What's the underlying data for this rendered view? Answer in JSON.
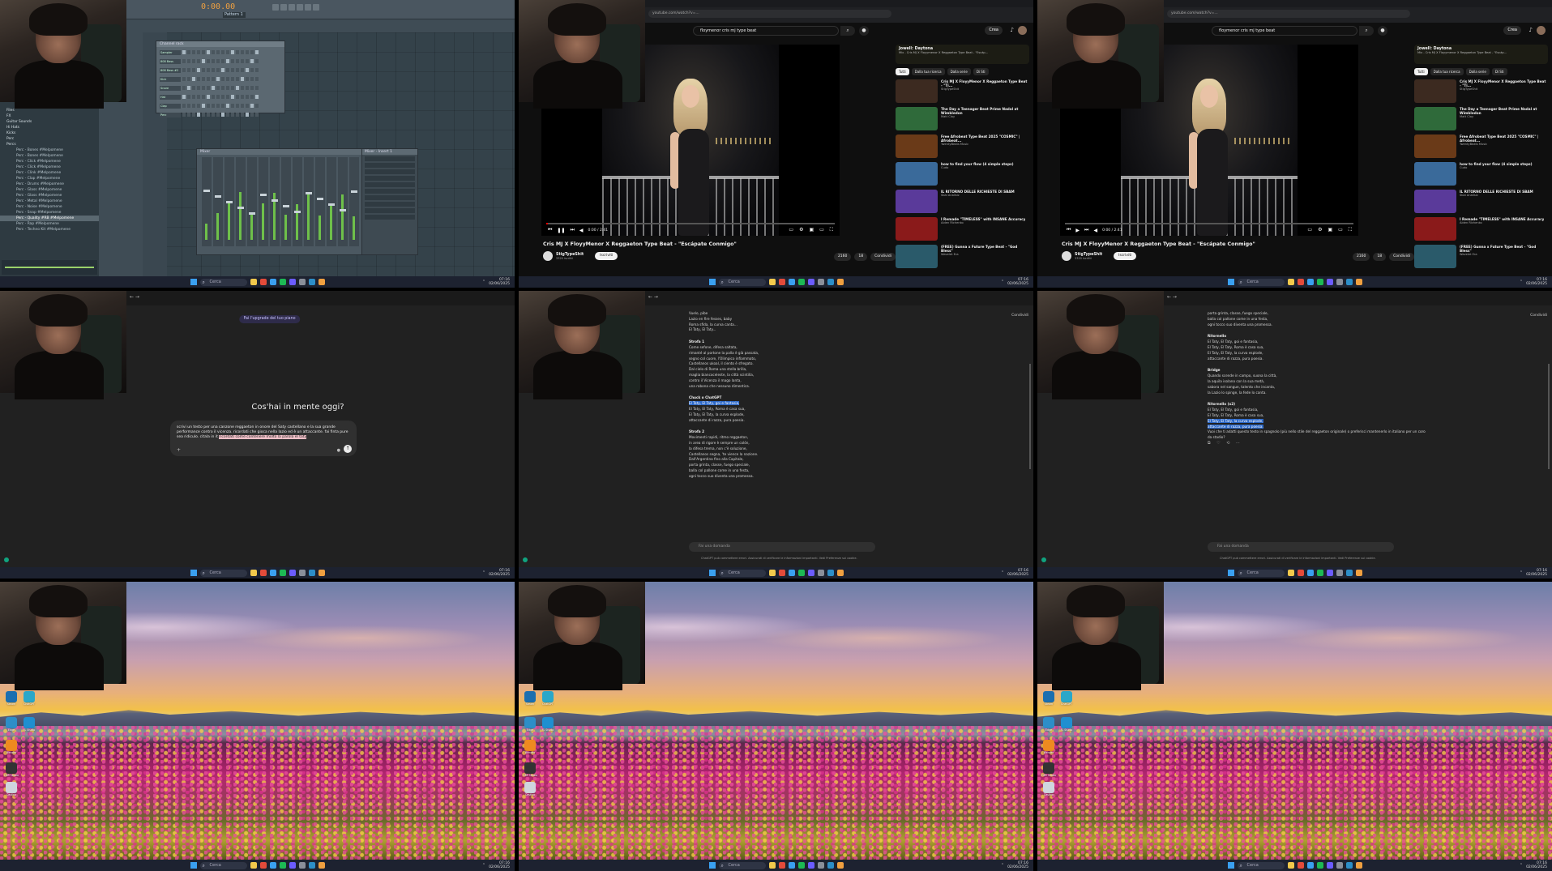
{
  "taskbar": {
    "search": "Cerca",
    "time": "07:16",
    "date": "02/06/2025"
  },
  "fl": {
    "time_display": "0:00.00",
    "pattern": "Pattern 1",
    "channel_rack_title": "Channel rack",
    "channels": [
      "Sampler",
      "808 Bass",
      "808 Bass #2",
      "Kick",
      "Snare",
      "Hat",
      "Clap",
      "Perc"
    ],
    "mixer_title": "Mixer",
    "fx_title": "Mixer - Insert 1",
    "browser": [
      {
        "label": "Inserts - Sample #Melpomene",
        "type": "file"
      },
      {
        "label": "Files",
        "type": "folder"
      },
      {
        "label": "FX",
        "type": "folder"
      },
      {
        "label": "Guitar Sounds",
        "type": "folder"
      },
      {
        "label": "Hi Hats",
        "type": "folder"
      },
      {
        "label": "Kicks",
        "type": "folder"
      },
      {
        "label": "Perc",
        "type": "folder"
      },
      {
        "label": "Percs",
        "type": "folder"
      },
      {
        "label": "Perc - Bones #Melpomene",
        "type": "file"
      },
      {
        "label": "Perc - Bones #Melpomene",
        "type": "file"
      },
      {
        "label": "Perc - Click #Melpomene",
        "type": "file"
      },
      {
        "label": "Perc - Click #Melpomene",
        "type": "file"
      },
      {
        "label": "Perc - Clink #Melpomene",
        "type": "file"
      },
      {
        "label": "Perc - Clap #Melpomene",
        "type": "file"
      },
      {
        "label": "Perc - Drums #Melpomene",
        "type": "file"
      },
      {
        "label": "Perc - Glass #Melpomene",
        "type": "file"
      },
      {
        "label": "Perc - Glass #Melpomene",
        "type": "file"
      },
      {
        "label": "Perc - Metal #Melpomene",
        "type": "file"
      },
      {
        "label": "Perc - Noise #Melpomene",
        "type": "file"
      },
      {
        "label": "Perc - Snap #Melpomene",
        "type": "file"
      },
      {
        "label": "Perc - Quality #RB #Melpomene",
        "type": "file",
        "selected": true
      },
      {
        "label": "Perc - Rap #Melpomene",
        "type": "file"
      },
      {
        "label": "Perc - Techno Kit #Melpomene",
        "type": "file"
      }
    ]
  },
  "yt": {
    "url": "youtube.com/watch?v=...",
    "search": "floymenor cris mj type beat",
    "create": "Crea",
    "video_title": "Cris MJ X FloyyMenor X Reggaeton Type Beat - \"Escápate Conmigo\"",
    "channel": "StigTypeShit",
    "subs": "3320 iscritti",
    "subscribe": "Iscriviti",
    "time": "0:00 / 2:41",
    "likes": "2160",
    "comments": "18",
    "share": "Condividi",
    "live_title": "Jowell: Daytona",
    "live_sub": "Mix - Cris MJ X Floyymenor X Reggaeton Type Beat - \"Escáp...",
    "chips": [
      "Tutti",
      "Dalla tua ricerca",
      "Dalla serie",
      "Di Sti"
    ],
    "recs": [
      {
        "title": "Cris MJ X FloyyMenor X Reggaeton Type Beat - \"Ti...",
        "channel": "StigTypeShit",
        "color": "#3c2a20"
      },
      {
        "title": "The Day a Teenager Beat Prime Nadal at Wimbledon",
        "channel": "Matt Clay",
        "color": "#2f6a3a"
      },
      {
        "title": "Free Afrobeat Type Beat 2025 \"COSMIC\" | Afrobeat...",
        "channel": "TwentyBeats Music",
        "color": "#6a3a18"
      },
      {
        "title": "how to find your flow (4 simple steps)",
        "channel": "Cudo",
        "color": "#3a6a9a"
      },
      {
        "title": "IL RITORNO DELLE RICHIESTE DI SBAM",
        "channel": "Sbai Analisiz",
        "color": "#5a3a9a"
      },
      {
        "title": "I Remade \"TIMELESS\" with INSANE Accuracy",
        "channel": "Aiden Richenko",
        "color": "#8a1a1a"
      },
      {
        "title": "(FREE) Gunna x Future Type Beat - \"God Bless\"",
        "channel": "Wavelet Era",
        "color": "#2a5a6a"
      }
    ]
  },
  "gpt": {
    "upgrade": "Fai l'upgrade del tuo piano",
    "hero": "Cos'hai in mente oggi?",
    "prompt_text": "scrivi un testo per una canzone reggaeton in onore del Saty castellano e la sua grande performance contro il vicenza. ricordati che gioca nella lazio ed è un attaccante. fai finta pure sea ridiculo. citala in it",
    "prompt_hl": "ricordati come contenere molto la parola el taty",
    "ask": "Fai una domanda",
    "note": "ChatGPT può commettere errori. Assicurati di verificare le informazioni importanti. Vedi Preferenze sui cookie.",
    "share": "Condividi",
    "lyrics_a": [
      {
        "t": "Vuelo, pibe",
        "h": false
      },
      {
        "t": "Lazio en fire fesses, baby",
        "h": false
      },
      {
        "t": "Roma sfida, la curva canta...",
        "h": false
      },
      {
        "t": "El Taty, El Taty...",
        "h": false
      },
      {
        "t": "Strofa 1",
        "h": true
      },
      {
        "t": "Come sefone, difesa saltata,",
        "h": false
      },
      {
        "t": "rimanté al portone la palla è già passata,",
        "h": false
      },
      {
        "t": "segno col cuore, l'Olimpico infiammato,",
        "h": false
      },
      {
        "t": "Castellanos ukoal, il ciento è sfregato.",
        "h": false
      },
      {
        "t": "Dal cielo di Roma una stella brilla,",
        "h": false
      },
      {
        "t": "maglia biancoceleste, la città scintilla,",
        "h": false
      },
      {
        "t": "contro il Vicenza il mago lanta,",
        "h": false
      },
      {
        "t": "una rabona che nessuno dimentica.",
        "h": false
      },
      {
        "t": "Chuck o ChatGPT",
        "h": true
      },
      {
        "t": "El Taty, El Taty, goi e fantasia,",
        "h": false
      },
      {
        "t": "El Taty, El Taty, Roma è casa sua,",
        "h": false
      },
      {
        "t": "El Taty, El Taty, la curva esplode,",
        "h": false
      },
      {
        "t": "attaccante di razza, pura poesia.",
        "h": false
      },
      {
        "t": "Strofa 2",
        "h": true
      },
      {
        "t": "Movimenti rapidi, ritmo reggaeton,",
        "h": false
      },
      {
        "t": "in area di rigore è sempre un colón,",
        "h": false
      },
      {
        "t": "la difesa trema, non c'è soluzione,",
        "h": false
      },
      {
        "t": "Castellanos segna, 'te vience la nazione.",
        "h": false
      },
      {
        "t": "Dall'Argentina fino alla Capitale,",
        "h": false
      },
      {
        "t": "porta grinta, classe, fuego speciale,",
        "h": false
      },
      {
        "t": "balla col pallone come in una festa,",
        "h": false
      },
      {
        "t": "ogni tocco suo diventa una promessa.",
        "h": false
      }
    ],
    "lyrics_b": [
      {
        "t": "porta grinta, classe, fuego speciale,",
        "h": false
      },
      {
        "t": "balla col pallone come in una festa,",
        "h": false
      },
      {
        "t": "ogni tocco suo diventa una promessa.",
        "h": false
      },
      {
        "t": "Ritornello",
        "h": true
      },
      {
        "t": "El Taty, El Taty, goi e fantasia,",
        "h": false
      },
      {
        "t": "El Taty, El Taty, Roma è casa sua,",
        "h": false
      },
      {
        "t": "El Taty, El Taty, la curva esplode,",
        "h": false
      },
      {
        "t": "attaccante di razza, pura poesia.",
        "h": false
      },
      {
        "t": "Bridge",
        "h": true
      },
      {
        "t": "Quando scende in campo, suona la città,",
        "h": false
      },
      {
        "t": "la aquila isolano con la sua metà,",
        "h": false
      },
      {
        "t": "sabora nel sangue, talento che incanta,",
        "h": false
      },
      {
        "t": "la Lazio lo spinge, la fede lo canta.",
        "h": false
      },
      {
        "t": "Ritornello (x2)",
        "h": true
      },
      {
        "t": "El Taty, El Taty, goi e fantasia,",
        "h": false
      },
      {
        "t": "El Taty, El Taty, Roma è casa sua,",
        "h": false
      },
      {
        "t": "El Taty, El Taty, la curva esplode,",
        "h": false
      },
      {
        "t": "attaccante di razza, pura poesia.",
        "h": false
      },
      {
        "t": "Vuoi che ti adatti questo testo in spagnolo (più nello stile del reggaeton originale) o preferisci mantenerlo in italiano per un coro da stadio?",
        "h": false
      }
    ]
  },
  "desktop": {
    "icons": [
      {
        "label": "Steam",
        "color": "#1b6fb0"
      },
      {
        "label": "ChatGPT",
        "color": "#2aa7c9"
      },
      {
        "label": "Edge",
        "color": "#2d8ec8"
      },
      {
        "label": "FL Studio",
        "color": "#1f8fd0"
      },
      {
        "label": "Blender",
        "color": "#ee8a20"
      },
      {
        "label": "OBS Studio",
        "color": "#333"
      },
      {
        "label": "Cestino",
        "color": "#cfd6de"
      }
    ]
  },
  "colors": {
    "yt_red": "#ff0000",
    "fl_orange": "#f0a040",
    "win_blue": "#3aa0f0",
    "selection": "#2c68c7"
  }
}
